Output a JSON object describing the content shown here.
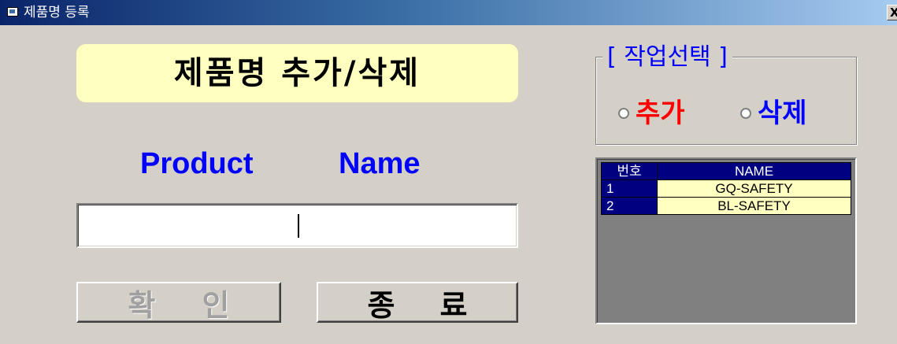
{
  "window": {
    "title": "제품명 등록",
    "close_label": "X"
  },
  "heading": "제품명 추가/삭제",
  "product_label": {
    "word1": "Product",
    "word2": "Name"
  },
  "product_input": {
    "value": "",
    "placeholder": ""
  },
  "buttons": {
    "ok": {
      "char1": "확",
      "char2": "인",
      "enabled": false
    },
    "exit": {
      "char1": "종",
      "char2": "료",
      "enabled": true
    }
  },
  "operation_select": {
    "legend": "[ 작업선택 ]",
    "options": [
      {
        "label": "추가",
        "color": "#ff0000",
        "selected": false
      },
      {
        "label": "삭제",
        "color": "#0000ff",
        "selected": false
      }
    ]
  },
  "product_grid": {
    "columns": [
      "번호",
      "NAME"
    ],
    "rows": [
      {
        "no": "1",
        "name": "GQ-SAFETY"
      },
      {
        "no": "2",
        "name": "BL-SAFETY"
      }
    ]
  },
  "colors": {
    "heading_bg": "#ffffc0",
    "label_blue": "#0000ff",
    "grid_header": "#000080",
    "face": "#d4d0c8"
  }
}
